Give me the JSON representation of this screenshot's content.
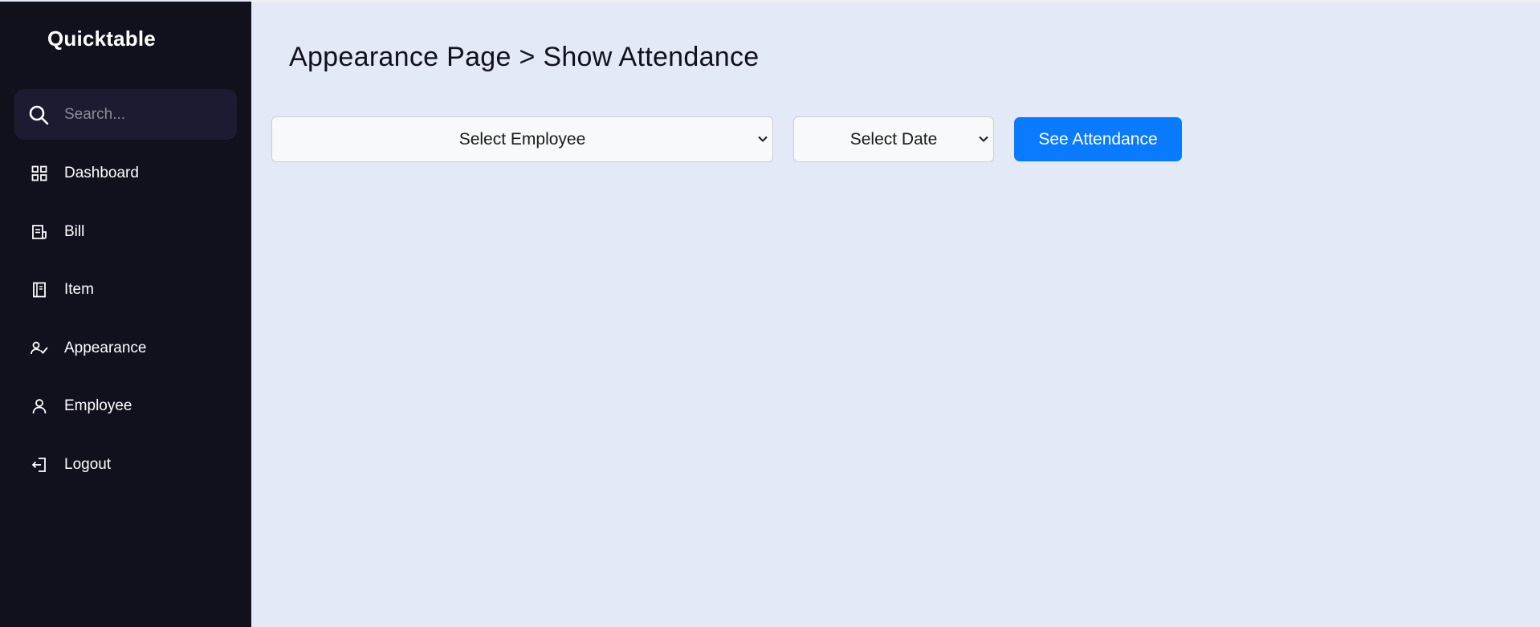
{
  "sidebar": {
    "brand": "Quicktable",
    "search": {
      "placeholder": "Search..."
    },
    "items": [
      {
        "label": "Dashboard",
        "icon": "grid-icon"
      },
      {
        "label": "Bill",
        "icon": "receipt-icon"
      },
      {
        "label": "Item",
        "icon": "notebook-icon"
      },
      {
        "label": "Appearance",
        "icon": "user-check-icon"
      },
      {
        "label": "Employee",
        "icon": "user-icon"
      },
      {
        "label": "Logout",
        "icon": "logout-icon"
      }
    ]
  },
  "main": {
    "title": "Appearance Page > Show Attendance",
    "employee_select": {
      "selected": "Select Employee"
    },
    "date_select": {
      "selected": "Select Date"
    },
    "submit_label": "See Attendance"
  },
  "colors": {
    "sidebar_bg": "#11101d",
    "search_bg": "#1d1b31",
    "page_bg": "#e4e9f7",
    "accent": "#0a7bff"
  }
}
